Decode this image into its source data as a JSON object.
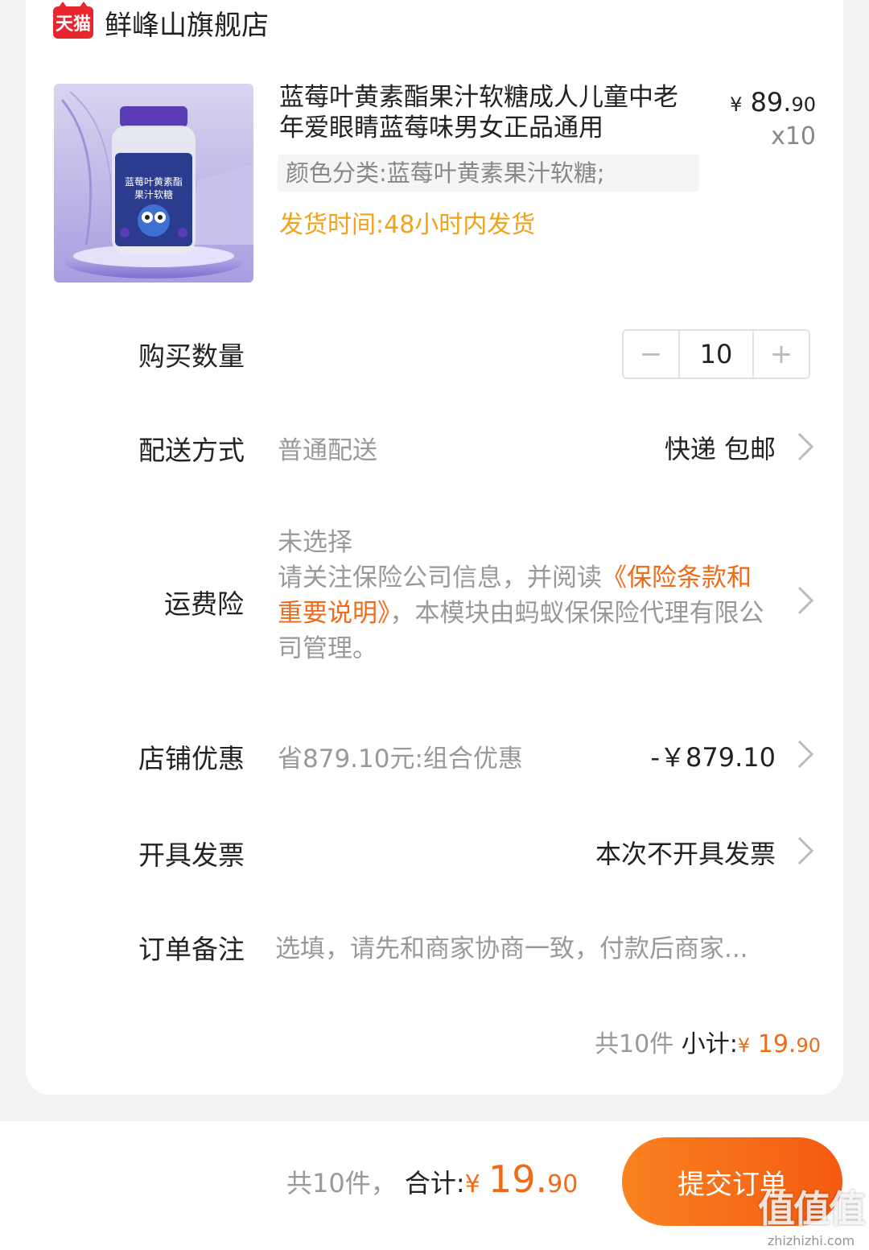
{
  "shop": {
    "badge": "天猫",
    "name": "鲜峰山旗舰店"
  },
  "product": {
    "title": "蓝莓叶黄素酯果汁软糖成人儿童中老年爱眼睛蓝莓味男女正品通用",
    "price_yen": "¥",
    "price_int": "89.",
    "price_dec": "90",
    "quantity": "x10",
    "sku": "颜色分类:蓝莓叶黄素果汁软糖;",
    "ship_time": "发货时间:48小时内发货",
    "image_label_line1": "蓝莓叶黄素酯",
    "image_label_line2": "果汁软糖"
  },
  "quantity_row": {
    "label": "购买数量",
    "minus": "−",
    "value": "10",
    "plus": "+"
  },
  "delivery_row": {
    "label": "配送方式",
    "value": "普通配送",
    "right": "快递 包邮"
  },
  "insurance_row": {
    "label": "运费险",
    "status": "未选择",
    "text_before": "请关注保险公司信息，并阅读",
    "link": "《保险条款和重要说明》",
    "text_after": "，本模块由蚂蚁保保险代理有限公司管理。"
  },
  "discount_row": {
    "label": "店铺优惠",
    "value": "省879.10元:组合优惠",
    "right": "-￥879.10"
  },
  "invoice_row": {
    "label": "开具发票",
    "right": "本次不开具发票"
  },
  "note_row": {
    "label": "订单备注",
    "placeholder": "选填，请先和商家协商一致，付款后商家..."
  },
  "subtotal": {
    "count": "共10件",
    "label": "小计:",
    "yen": "¥",
    "int": "19.",
    "dec": "90"
  },
  "bottom": {
    "count": "共10件，",
    "label": "合计:",
    "yen": "¥",
    "int": "19.",
    "dec": "90",
    "submit": "提交订单"
  },
  "watermark": {
    "logo": "值值值",
    "url": "zhizhizhi.com"
  },
  "colors": {
    "accent_orange": "#f06a17",
    "ship_yellow": "#f0a21a",
    "tmall_red": "#e8262e"
  }
}
